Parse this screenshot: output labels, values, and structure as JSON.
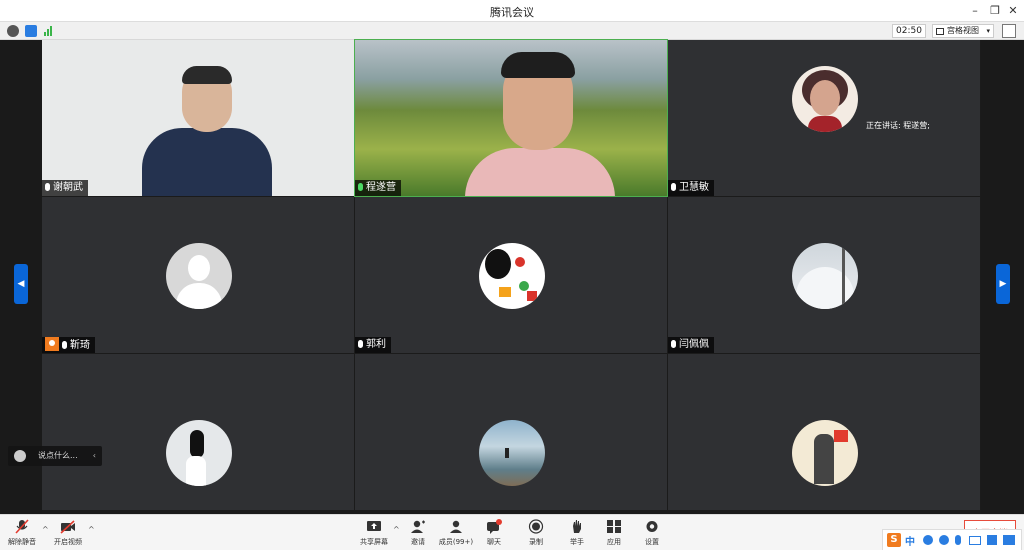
{
  "window": {
    "title": "腾讯会议",
    "minimize": "–",
    "restore": "❐",
    "close": "✕"
  },
  "infobar": {
    "timer": "02:50",
    "view_mode": "宫格视图",
    "dropdown": "▾"
  },
  "participants": [
    {
      "name": "谢朝武",
      "mic": "on"
    },
    {
      "name": "程遂营",
      "mic": "speaking"
    },
    {
      "name": "卫慧敏",
      "mic": "on"
    },
    {
      "name": "靳琦",
      "mic": "on",
      "host": true
    },
    {
      "name": "郭利",
      "mic": "on"
    },
    {
      "name": "闫佩佩",
      "mic": "on"
    },
    {
      "name": "",
      "mic": "on"
    },
    {
      "name": "",
      "mic": "on"
    },
    {
      "name": "",
      "mic": "on"
    }
  ],
  "speaking_now": "正在讲话: 程遂营;",
  "nav": {
    "left": "◀",
    "right": "▶"
  },
  "chat": {
    "placeholder": "说点什么...",
    "collapse": "‹"
  },
  "toolbar": {
    "unmute": "解除静音",
    "start_video": "开启视频",
    "share_screen": "共享屏幕",
    "invite": "邀请",
    "members": "成员(99+)",
    "chat": "聊天",
    "record": "录制",
    "raise_hand": "举手",
    "apps": "应用",
    "settings": "设置",
    "end_meeting": "离开会议",
    "caret": "^"
  },
  "ime": {
    "logo": "S",
    "lang": "中"
  },
  "colors": {
    "accent": "#0a66d8",
    "speaking": "#4caf50",
    "end": "#e74c3c"
  }
}
